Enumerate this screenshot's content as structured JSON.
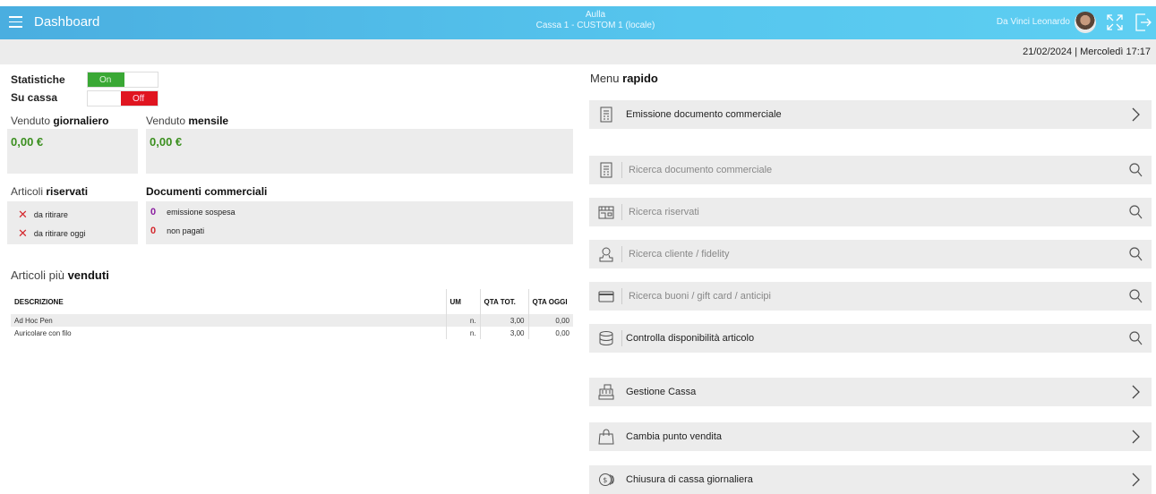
{
  "header": {
    "title": "Dashboard",
    "store": "Aulla",
    "register": "Cassa 1 - CUSTOM 1 (locale)",
    "user": "Da Vinci Leonardo"
  },
  "date_text": "21/02/2024 | Mercoledì 17:17",
  "stats": {
    "statistiche_label": "Statistiche",
    "su_cassa_label": "Su cassa",
    "on_label": "On",
    "off_label": "Off"
  },
  "sales": {
    "daily_pre": "Venduto ",
    "daily_bold": "giornaliero",
    "daily_value": "0,00 €",
    "monthly_pre": "Venduto ",
    "monthly_bold": "mensile",
    "monthly_value": "0,00 €"
  },
  "reserved": {
    "title_pre": "Articoli ",
    "title_bold": "riservati",
    "items": [
      "da ritirare",
      "da ritirare oggi"
    ]
  },
  "documents": {
    "title": "Documenti commerciali",
    "items": [
      {
        "count": "0",
        "label": "emissione sospesa",
        "color": "#8b1fa0"
      },
      {
        "count": "0",
        "label": "non pagati",
        "color": "#d4282e"
      }
    ]
  },
  "best_sellers": {
    "title_pre": "Articoli più ",
    "title_bold": "venduti",
    "columns": [
      "DESCRIZIONE",
      "UM",
      "QTA TOT.",
      "QTA OGGI"
    ],
    "rows": [
      [
        "Ad Hoc Pen",
        "n.",
        "3,00",
        "0,00"
      ],
      [
        "Auricolare con filo",
        "n.",
        "3,00",
        "0,00"
      ]
    ]
  },
  "quick_menu": {
    "title_pre": "Menu ",
    "title_bold": "rapido",
    "items": [
      {
        "label": "Emissione documento commerciale",
        "icon": "document-icon",
        "action": "chevron-right-icon"
      },
      {
        "label": "Ricerca documento commerciale",
        "icon": "document-icon",
        "action": "search-icon"
      },
      {
        "label": "Ricerca riservati",
        "icon": "store-icon",
        "action": "search-icon"
      },
      {
        "label": "Ricerca cliente / fidelity",
        "icon": "person-icon",
        "action": "search-icon"
      },
      {
        "label": "Ricerca buoni / gift card / anticipi",
        "icon": "card-icon",
        "action": "search-icon"
      },
      {
        "label": "Controlla disponibilità articolo",
        "icon": "database-icon",
        "action": "search-icon"
      },
      {
        "label": "Gestione Cassa",
        "icon": "cash-register-icon",
        "action": "chevron-right-icon"
      },
      {
        "label": "Cambia punto vendita",
        "icon": "shopping-bag-icon",
        "action": "chevron-right-icon"
      },
      {
        "label": "Chiusura di cassa giornaliera",
        "icon": "coins-icon",
        "action": "chevron-right-icon"
      }
    ]
  },
  "colors": {
    "accent": "#4aaee0",
    "on": "#3aa835",
    "off": "#e01520",
    "money": "#3b8f1f"
  }
}
